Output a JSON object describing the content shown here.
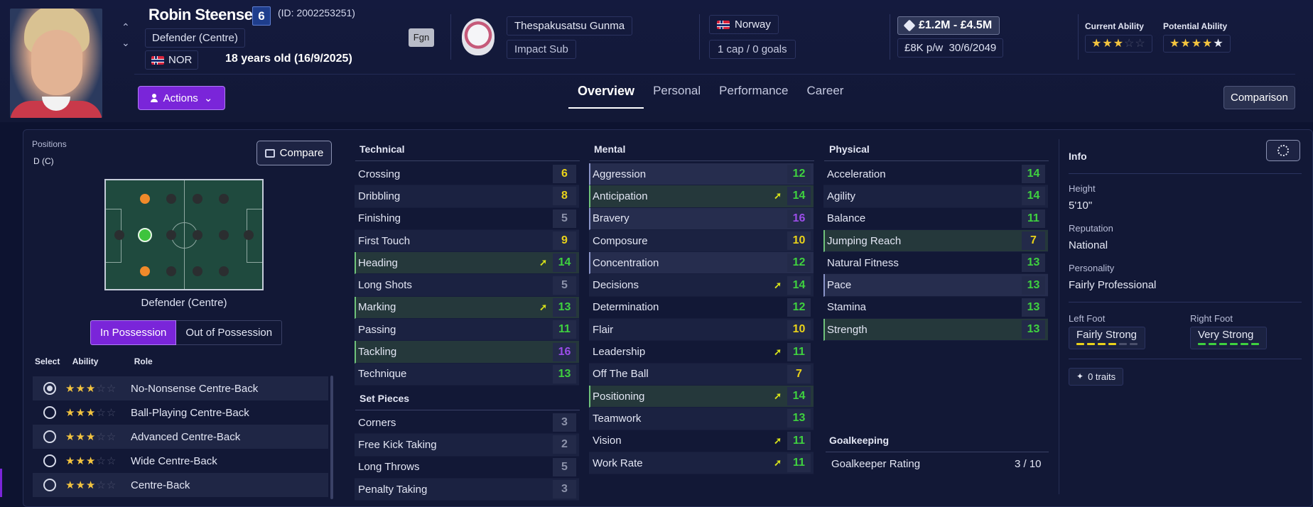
{
  "player": {
    "name": "Robin Steensen",
    "number": "6",
    "id_text": "(ID: 2002253251)",
    "position": "Defender (Centre)",
    "nation_code": "NOR",
    "age_text": "18 years old (16/9/2025)",
    "foreign_badge": "Fgn"
  },
  "club": {
    "name": "Thespakusatsu Gunma",
    "role": "Impact Sub"
  },
  "international": {
    "nation": "Norway",
    "caps": "1 cap / 0 goals"
  },
  "contract": {
    "value": "£1.2M - £4.5M",
    "wage": "£8K p/w",
    "expiry": "30/6/2049"
  },
  "ability": {
    "current_label": "Current Ability",
    "current_stars": 2.5,
    "potential_label": "Potential Ability",
    "potential_stars": 4.5
  },
  "nav": {
    "actions_label": "Actions",
    "tabs": [
      "Overview",
      "Personal",
      "Performance",
      "Career"
    ],
    "active_tab": "Overview",
    "comparison_label": "Comparison"
  },
  "positions": {
    "label": "Positions",
    "value": "D (C)",
    "compare_label": "Compare",
    "pitch_caption": "Defender (Centre)",
    "in_possession": "In Possession",
    "out_possession": "Out of Possession",
    "head_select": "Select",
    "head_ability": "Ability",
    "head_role": "Role",
    "roles": [
      {
        "name": "No-Nonsense Centre-Back",
        "stars": 2.5,
        "selected": true
      },
      {
        "name": "Ball-Playing Centre-Back",
        "stars": 2.5,
        "selected": false
      },
      {
        "name": "Advanced Centre-Back",
        "stars": 2.5,
        "selected": false
      },
      {
        "name": "Wide Centre-Back",
        "stars": 2.5,
        "selected": false
      },
      {
        "name": "Centre-Back",
        "stars": 2.5,
        "selected": false
      }
    ]
  },
  "technical": {
    "title": "Technical",
    "attrs": [
      {
        "name": "Crossing",
        "value": 6,
        "color": "yellow",
        "hl": ""
      },
      {
        "name": "Dribbling",
        "value": 8,
        "color": "yellow",
        "hl": ""
      },
      {
        "name": "Finishing",
        "value": 5,
        "color": "grey",
        "hl": ""
      },
      {
        "name": "First Touch",
        "value": 9,
        "color": "yellow",
        "hl": ""
      },
      {
        "name": "Heading",
        "value": 14,
        "color": "green",
        "hl": "green",
        "arrow": true
      },
      {
        "name": "Long Shots",
        "value": 5,
        "color": "grey",
        "hl": ""
      },
      {
        "name": "Marking",
        "value": 13,
        "color": "green",
        "hl": "green",
        "arrow": true
      },
      {
        "name": "Passing",
        "value": 11,
        "color": "green",
        "hl": ""
      },
      {
        "name": "Tackling",
        "value": 16,
        "color": "purple",
        "hl": "green"
      },
      {
        "name": "Technique",
        "value": 13,
        "color": "green",
        "hl": ""
      }
    ]
  },
  "set_pieces": {
    "title": "Set Pieces",
    "attrs": [
      {
        "name": "Corners",
        "value": 3,
        "color": "grey",
        "hl": ""
      },
      {
        "name": "Free Kick Taking",
        "value": 2,
        "color": "grey",
        "hl": ""
      },
      {
        "name": "Long Throws",
        "value": 5,
        "color": "grey",
        "hl": ""
      },
      {
        "name": "Penalty Taking",
        "value": 3,
        "color": "grey",
        "hl": ""
      }
    ]
  },
  "mental": {
    "title": "Mental",
    "attrs": [
      {
        "name": "Aggression",
        "value": 12,
        "color": "green",
        "hl": "blue"
      },
      {
        "name": "Anticipation",
        "value": 14,
        "color": "green",
        "hl": "green",
        "arrow": true
      },
      {
        "name": "Bravery",
        "value": 16,
        "color": "purple",
        "hl": "blue"
      },
      {
        "name": "Composure",
        "value": 10,
        "color": "yellow",
        "hl": ""
      },
      {
        "name": "Concentration",
        "value": 12,
        "color": "green",
        "hl": "blue"
      },
      {
        "name": "Decisions",
        "value": 14,
        "color": "green",
        "hl": "",
        "arrow": true
      },
      {
        "name": "Determination",
        "value": 12,
        "color": "green",
        "hl": ""
      },
      {
        "name": "Flair",
        "value": 10,
        "color": "yellow",
        "hl": ""
      },
      {
        "name": "Leadership",
        "value": 11,
        "color": "green",
        "hl": "",
        "arrow": true
      },
      {
        "name": "Off The Ball",
        "value": 7,
        "color": "yellow",
        "hl": ""
      },
      {
        "name": "Positioning",
        "value": 14,
        "color": "green",
        "hl": "green",
        "arrow": true
      },
      {
        "name": "Teamwork",
        "value": 13,
        "color": "green",
        "hl": ""
      },
      {
        "name": "Vision",
        "value": 11,
        "color": "green",
        "hl": "",
        "arrow": true
      },
      {
        "name": "Work Rate",
        "value": 11,
        "color": "green",
        "hl": "",
        "arrow": true
      }
    ]
  },
  "physical": {
    "title": "Physical",
    "attrs": [
      {
        "name": "Acceleration",
        "value": 14,
        "color": "green",
        "hl": ""
      },
      {
        "name": "Agility",
        "value": 14,
        "color": "green",
        "hl": ""
      },
      {
        "name": "Balance",
        "value": 11,
        "color": "green",
        "hl": ""
      },
      {
        "name": "Jumping Reach",
        "value": 7,
        "color": "yellow",
        "hl": "green"
      },
      {
        "name": "Natural Fitness",
        "value": 13,
        "color": "green",
        "hl": ""
      },
      {
        "name": "Pace",
        "value": 13,
        "color": "green",
        "hl": "blue"
      },
      {
        "name": "Stamina",
        "value": 13,
        "color": "green",
        "hl": ""
      },
      {
        "name": "Strength",
        "value": 13,
        "color": "green",
        "hl": "green"
      }
    ]
  },
  "goalkeeping": {
    "title": "Goalkeeping",
    "label": "Goalkeeper Rating",
    "value": "3 / 10"
  },
  "info": {
    "title": "Info",
    "height_label": "Height",
    "height": "5'10\"",
    "reputation_label": "Reputation",
    "reputation": "National",
    "personality_label": "Personality",
    "personality": "Fairly Professional",
    "left_foot_label": "Left Foot",
    "left_foot": "Fairly Strong",
    "left_foot_level": 4,
    "right_foot_label": "Right Foot",
    "right_foot": "Very Strong",
    "right_foot_level": 6,
    "traits": "0 traits"
  },
  "colors": {
    "accent": "#7a25d9",
    "green": "#3fd13f",
    "yellow": "#e9d21a",
    "purple": "#9b4de8",
    "grey": "#8c92aa"
  }
}
